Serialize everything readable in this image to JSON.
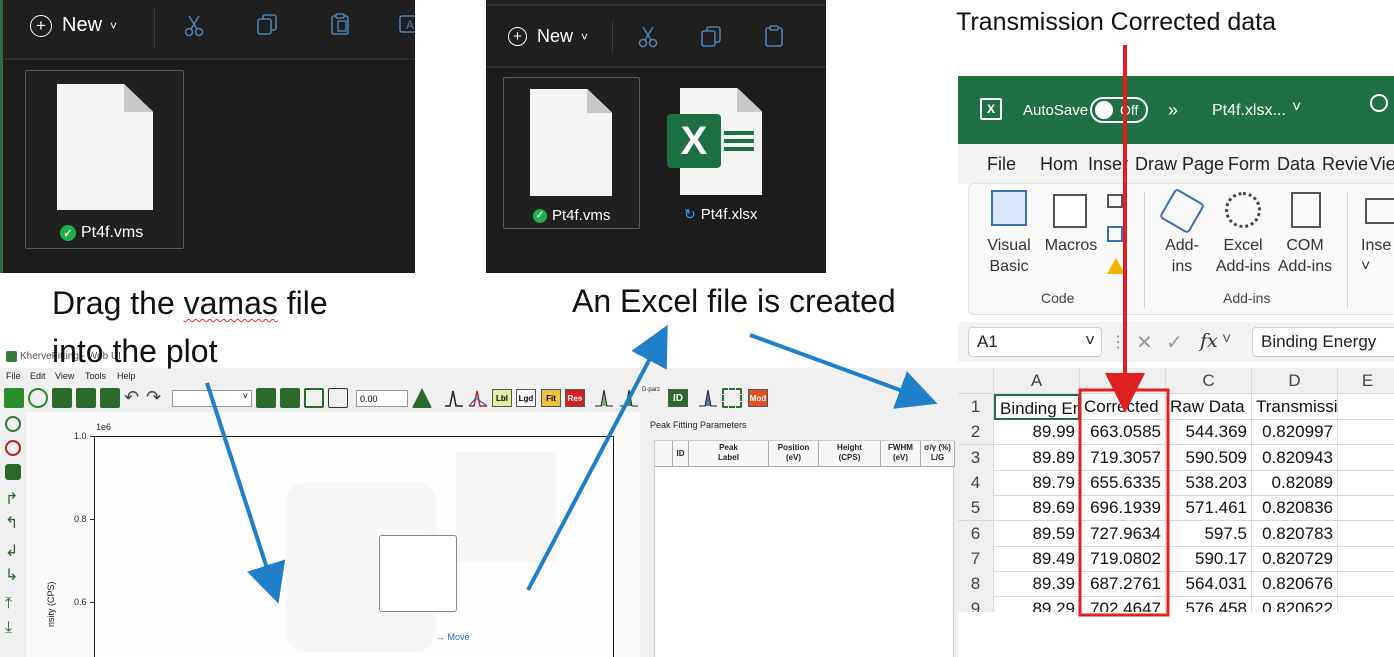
{
  "explorer_left": {
    "new_label": "New",
    "file_name": "Pt4f.vms"
  },
  "explorer_right": {
    "new_label": "New",
    "files": [
      {
        "name": "Pt4f.vms",
        "status": "synced"
      },
      {
        "name": "Pt4f.xlsx",
        "status": "syncing"
      }
    ]
  },
  "captions": {
    "top_right": "Transmission Corrected data",
    "drag_line1": "Drag the vamas file",
    "drag_line2": "into the plot",
    "excel_created": "An Excel file is created"
  },
  "excel": {
    "autosave_label": "AutoSave",
    "autosave_state": "Off",
    "overflow_label": "»",
    "file_name": "Pt4f.xlsx...",
    "menu": [
      "File",
      "Hom",
      "Inser",
      "Draw",
      "Page",
      "Form",
      "Data",
      "Revie",
      "Vie"
    ],
    "ribbon": {
      "code_buttons": [
        {
          "line1": "Visual",
          "line2": "Basic"
        },
        {
          "line1": "Macros",
          "line2": ""
        }
      ],
      "addin_buttons": [
        {
          "line1": "Add-",
          "line2": "ins"
        },
        {
          "line1": "Excel",
          "line2": "Add-ins"
        },
        {
          "line1": "COM",
          "line2": "Add-ins"
        },
        {
          "line1": "Inse",
          "line2": "˅"
        }
      ],
      "groups": [
        "Code",
        "Add-ins"
      ]
    },
    "name_box": "A1",
    "formula_fx": "fx",
    "formula_value": "Binding Energy",
    "columns": [
      "A",
      "B",
      "C",
      "D",
      "E"
    ],
    "row_numbers": [
      "1",
      "2",
      "3",
      "4",
      "5",
      "6",
      "7",
      "8",
      "9"
    ],
    "header_row": [
      "Binding En",
      "Corrected",
      "Raw Data",
      "Transmission",
      ""
    ],
    "rows": [
      [
        "89.99",
        "663.0585",
        "544.369",
        "0.820997",
        ""
      ],
      [
        "89.89",
        "719.3057",
        "590.509",
        "0.820943",
        ""
      ],
      [
        "89.79",
        "655.6335",
        "538.203",
        "0.82089",
        ""
      ],
      [
        "89.69",
        "696.1939",
        "571.461",
        "0.820836",
        ""
      ],
      [
        "89.59",
        "727.9634",
        "597.5",
        "0.820783",
        ""
      ],
      [
        "89.49",
        "719.0802",
        "590.17",
        "0.820729",
        ""
      ],
      [
        "89.39",
        "687.2761",
        "564.031",
        "0.820676",
        ""
      ],
      [
        "89.29",
        "702.4647",
        "576.458",
        "0.820622",
        ""
      ]
    ],
    "highlight_color": "#e02020"
  },
  "kherve": {
    "title": "KherveFitting - Web UI",
    "menu": [
      "File",
      "Edit",
      "View",
      "Tools",
      "Help"
    ],
    "zoom_value": "0.00",
    "toolbar_labels": [
      "Lbl",
      "Lgd",
      "Fit",
      "Res",
      "D-parz",
      "ID",
      "Mod"
    ],
    "plot_exponent": "1e6",
    "y_ticks": [
      "1.0",
      "0.8",
      "0.6"
    ],
    "y_label": "nsity (CPS)",
    "move_label": "→ Move",
    "peak_params_title": "Peak Fitting Parameters",
    "peak_columns": [
      {
        "line1": "ID",
        "line2": ""
      },
      {
        "line1": "Peak",
        "line2": "Label"
      },
      {
        "line1": "Position",
        "line2": "(eV)"
      },
      {
        "line1": "Height",
        "line2": "(CPS)"
      },
      {
        "line1": "FWHM",
        "line2": "(eV)"
      },
      {
        "line1": "σ/γ (%)",
        "line2": "L/G"
      }
    ]
  },
  "colors": {
    "arrow": "#1f7fc8",
    "red_arrow": "#e02020",
    "excel_green": "#1f7145",
    "explorer_dark": "#1c1c1c"
  }
}
